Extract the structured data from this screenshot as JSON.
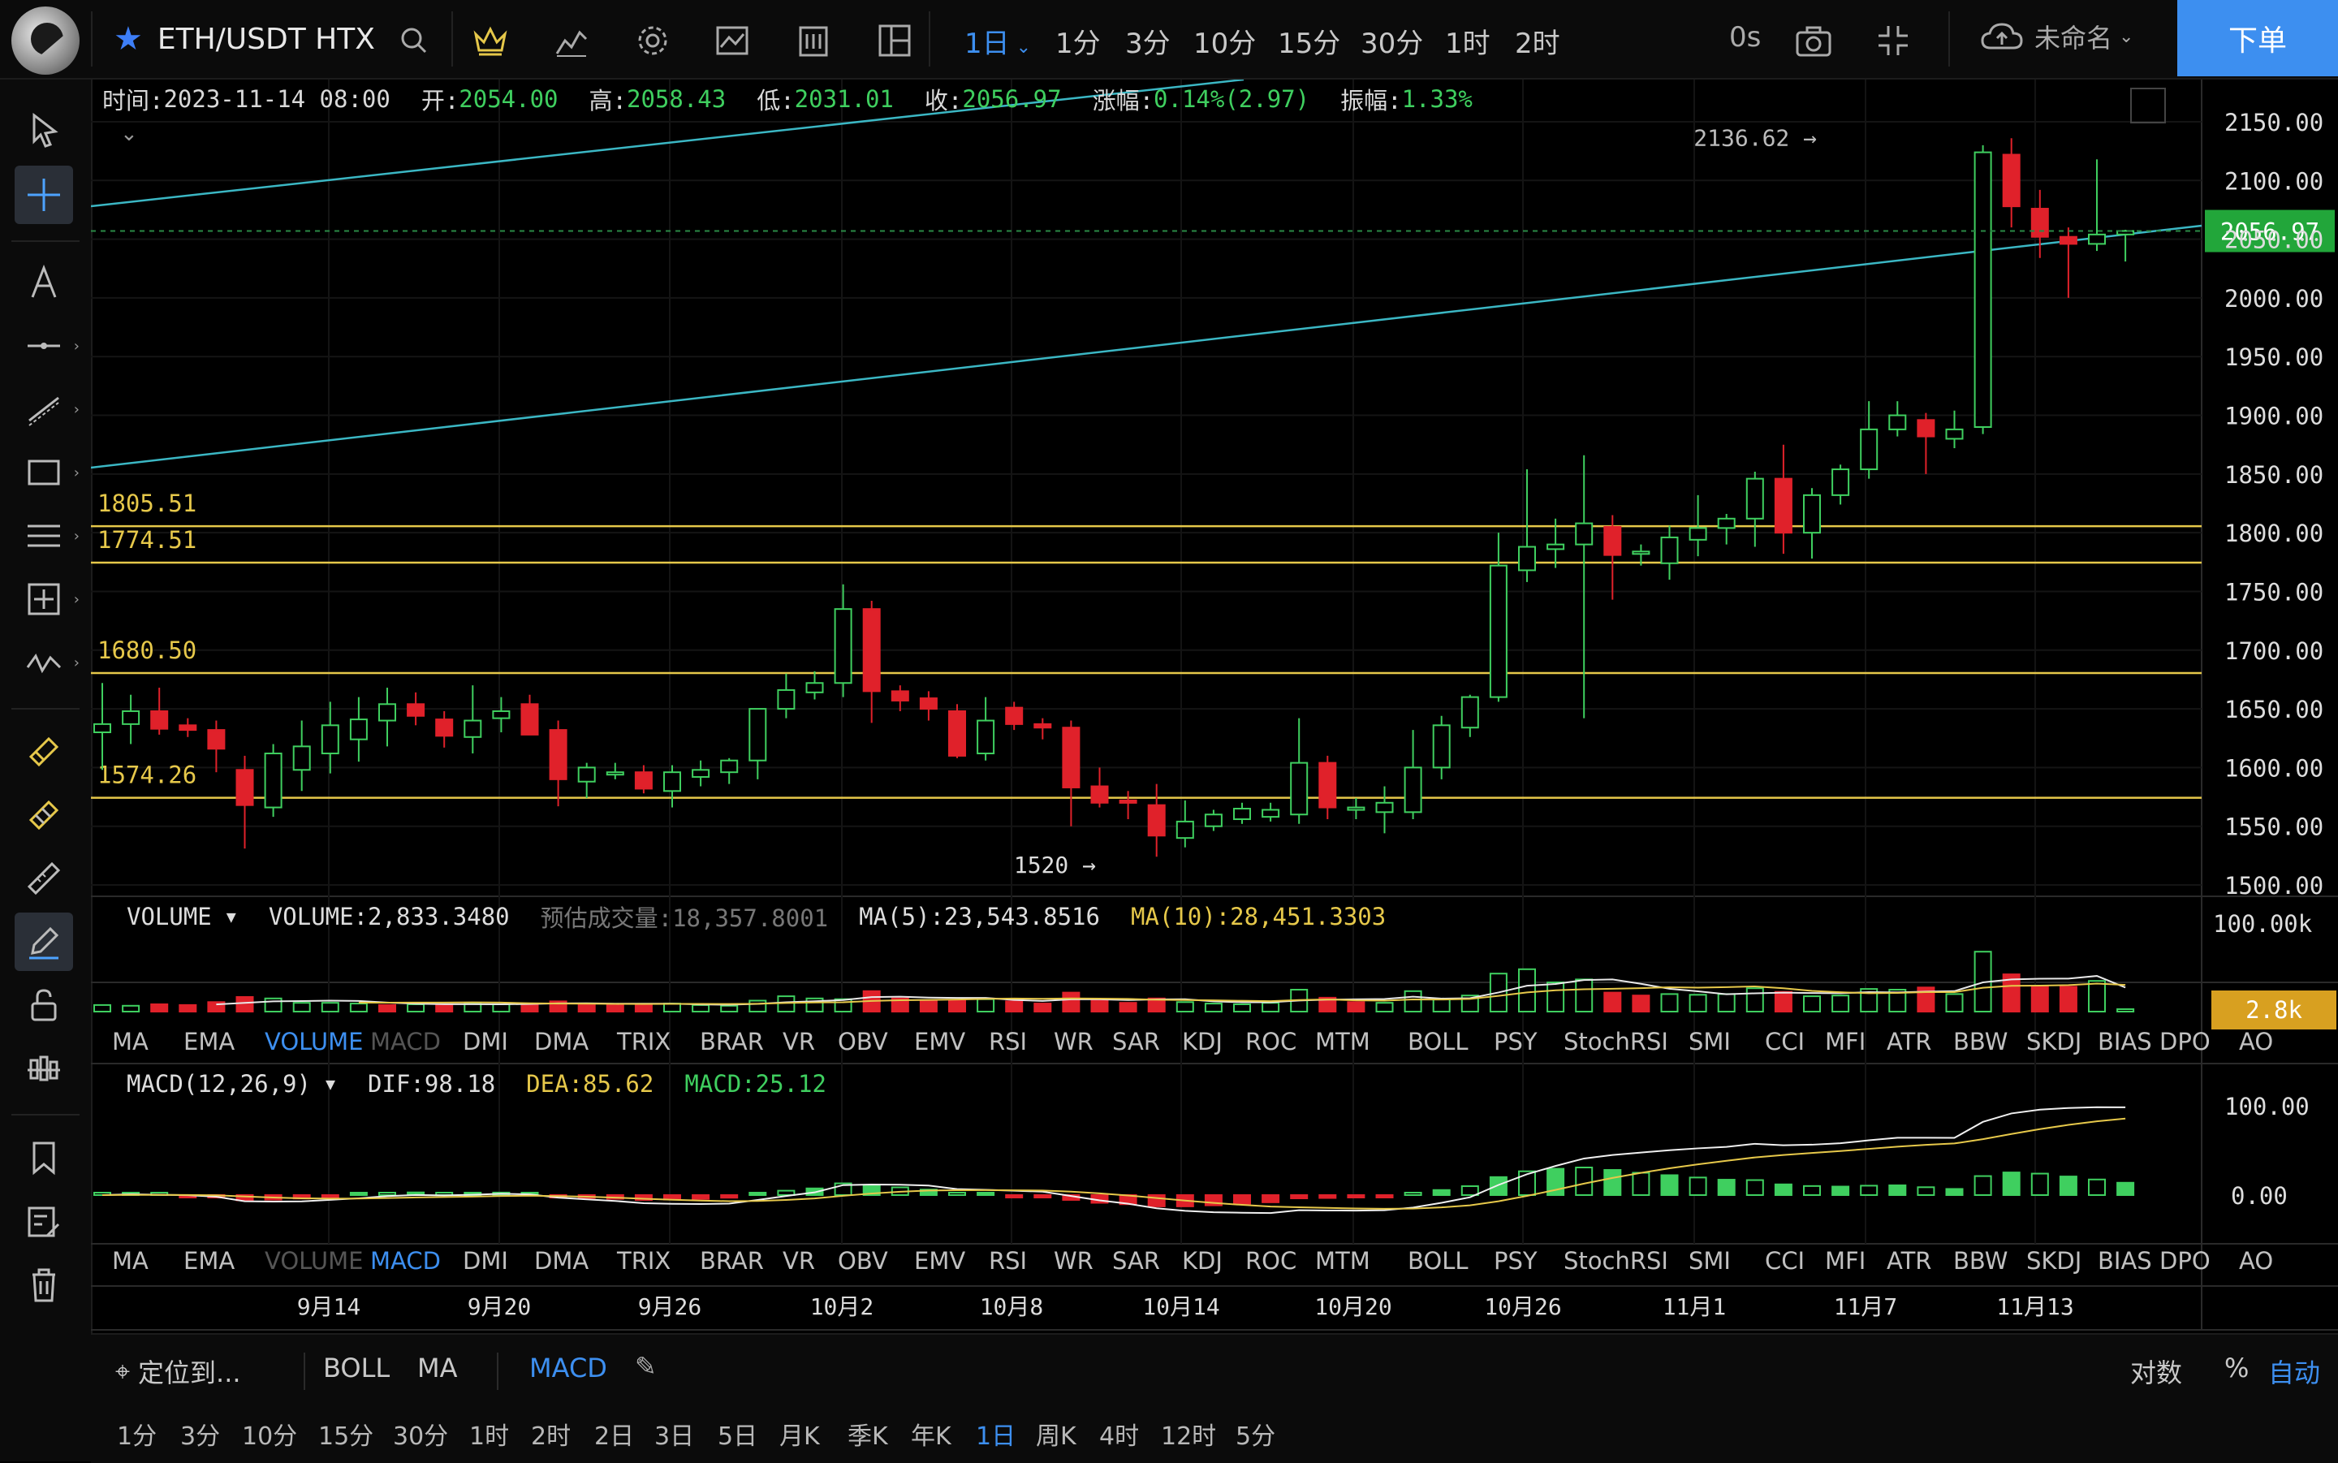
{
  "header": {
    "symbol": "ETH/USDT HTX",
    "timeframe_selected": "1日",
    "timeframes": [
      "1分",
      "3分",
      "10分",
      "15分",
      "30分",
      "1时",
      "2时"
    ],
    "countdown": "0s",
    "account_name": "未命名",
    "order_button": "下单"
  },
  "ohlc_bar": {
    "time_label": "时间:",
    "time_value": "2023-11-14 08:00",
    "open_label": "开:",
    "open": "2054.00",
    "high_label": "高:",
    "high": "2058.43",
    "low_label": "低:",
    "low": "2031.01",
    "close_label": "收:",
    "close": "2056.97",
    "change_label": "涨幅:",
    "change": "0.14%(2.97)",
    "amplitude_label": "振幅:",
    "amplitude": "1.33%"
  },
  "price_axis": {
    "ticks": [
      "2150.00",
      "2100.00",
      "2050.00",
      "2000.00",
      "1950.00",
      "1900.00",
      "1850.00",
      "1800.00",
      "1750.00",
      "1700.00",
      "1650.00",
      "1600.00",
      "1550.00",
      "1500.00"
    ],
    "current_price": "2056.97"
  },
  "horizontal_levels": [
    "1805.51",
    "1774.51",
    "1680.50",
    "1574.26"
  ],
  "annotations": {
    "high_marker": "2136.62",
    "low_marker": "1520"
  },
  "volume_panel": {
    "name": "VOLUME",
    "volume_text": "VOLUME:2,833.3480",
    "estimate_text": "预估成交量:18,357.8001",
    "ma5_text": "MA(5):23,543.8516",
    "ma10_text": "MA(10):28,451.3303",
    "axis_top": "100.00k",
    "current_badge": "2.8k"
  },
  "macd_panel": {
    "name": "MACD(12,26,9)",
    "dif_text": "DIF:98.18",
    "dea_text": "DEA:85.62",
    "macd_text": "MACD:25.12",
    "axis_ticks": [
      "100.00",
      "0.00"
    ]
  },
  "indicator_tabs": [
    "MA",
    "EMA",
    "VOLUME",
    "MACD",
    "DMI",
    "DMA",
    "TRIX",
    "BRAR",
    "VR",
    "OBV",
    "EMV",
    "RSI",
    "WR",
    "SAR",
    "KDJ",
    "ROC",
    "MTM",
    "BOLL",
    "PSY",
    "StochRSI",
    "SMI",
    "CCI",
    "MFI",
    "ATR",
    "BBW",
    "SKDJ",
    "BIAS",
    "DPO",
    "AO"
  ],
  "date_axis": [
    "9月14",
    "9月20",
    "9月26",
    "10月2",
    "10月8",
    "10月14",
    "10月20",
    "10月26",
    "11月1",
    "11月7",
    "11月13"
  ],
  "bottom": {
    "locate": "定位到...",
    "overlays": [
      "BOLL",
      "MA"
    ],
    "sub_indicator": "MACD",
    "scale_log": "对数",
    "scale_pct": "%",
    "scale_auto": "自动",
    "periods": [
      "1分",
      "3分",
      "10分",
      "15分",
      "30分",
      "1时",
      "2时",
      "2日",
      "3日",
      "5日",
      "月K",
      "季K",
      "年K",
      "1日",
      "周K",
      "4时",
      "12时",
      "5分"
    ],
    "period_selected": "1日"
  },
  "colors": {
    "up": "#3fcf5f",
    "down": "#e0212a",
    "accent": "#3d8ff0",
    "level": "#e6c84a",
    "trend": "#3bb7c4",
    "badge_price": "#22a63a",
    "badge_vol": "#d8a020"
  },
  "chart_data": {
    "type": "candlestick",
    "price_range": [
      1485,
      2170
    ],
    "candles": [
      [
        1630,
        1672,
        1598,
        1637
      ],
      [
        1637,
        1662,
        1620,
        1648
      ],
      [
        1648,
        1668,
        1628,
        1633
      ],
      [
        1636,
        1642,
        1626,
        1632
      ],
      [
        1632,
        1640,
        1596,
        1616
      ],
      [
        1598,
        1610,
        1531,
        1568
      ],
      [
        1566,
        1620,
        1558,
        1612
      ],
      [
        1598,
        1640,
        1580,
        1618
      ],
      [
        1612,
        1656,
        1595,
        1636
      ],
      [
        1624,
        1660,
        1605,
        1641
      ],
      [
        1640,
        1668,
        1618,
        1654
      ],
      [
        1654,
        1664,
        1636,
        1644
      ],
      [
        1641,
        1648,
        1617,
        1627
      ],
      [
        1626,
        1670,
        1612,
        1640
      ],
      [
        1642,
        1660,
        1630,
        1648
      ],
      [
        1654,
        1662,
        1628,
        1628
      ],
      [
        1632,
        1640,
        1567,
        1590
      ],
      [
        1588,
        1604,
        1574,
        1600
      ],
      [
        1596,
        1604,
        1590,
        1596
      ],
      [
        1596,
        1602,
        1578,
        1582
      ],
      [
        1580,
        1602,
        1566,
        1596
      ],
      [
        1592,
        1606,
        1584,
        1598
      ],
      [
        1596,
        1608,
        1586,
        1606
      ],
      [
        1606,
        1650,
        1590,
        1650
      ],
      [
        1650,
        1680,
        1642,
        1666
      ],
      [
        1664,
        1682,
        1658,
        1672
      ],
      [
        1672,
        1756,
        1660,
        1735
      ],
      [
        1735,
        1742,
        1638,
        1665
      ],
      [
        1665,
        1670,
        1648,
        1657
      ],
      [
        1659,
        1665,
        1640,
        1650
      ],
      [
        1648,
        1654,
        1608,
        1610
      ],
      [
        1612,
        1660,
        1606,
        1640
      ],
      [
        1651,
        1656,
        1632,
        1637
      ],
      [
        1637,
        1642,
        1624,
        1634
      ],
      [
        1634,
        1640,
        1550,
        1583
      ],
      [
        1584,
        1600,
        1566,
        1570
      ],
      [
        1572,
        1580,
        1556,
        1570
      ],
      [
        1568,
        1586,
        1524,
        1542
      ],
      [
        1540,
        1572,
        1532,
        1554
      ],
      [
        1550,
        1564,
        1546,
        1560
      ],
      [
        1556,
        1570,
        1552,
        1565
      ],
      [
        1558,
        1570,
        1554,
        1564
      ],
      [
        1560,
        1642,
        1552,
        1604
      ],
      [
        1604,
        1610,
        1556,
        1566
      ],
      [
        1564,
        1574,
        1556,
        1566
      ],
      [
        1562,
        1584,
        1544,
        1570
      ],
      [
        1562,
        1632,
        1556,
        1600
      ],
      [
        1600,
        1644,
        1590,
        1636
      ],
      [
        1634,
        1662,
        1626,
        1660
      ],
      [
        1660,
        1800,
        1656,
        1772
      ],
      [
        1768,
        1854,
        1758,
        1788
      ],
      [
        1786,
        1812,
        1770,
        1790
      ],
      [
        1790,
        1866,
        1642,
        1808
      ],
      [
        1805,
        1815,
        1743,
        1781
      ],
      [
        1782,
        1790,
        1772,
        1784
      ],
      [
        1774,
        1806,
        1760,
        1796
      ],
      [
        1794,
        1832,
        1780,
        1804
      ],
      [
        1804,
        1816,
        1790,
        1812
      ],
      [
        1812,
        1852,
        1788,
        1846
      ],
      [
        1846,
        1875,
        1782,
        1800
      ],
      [
        1800,
        1838,
        1778,
        1832
      ],
      [
        1832,
        1858,
        1824,
        1854
      ],
      [
        1854,
        1912,
        1846,
        1888
      ],
      [
        1888,
        1912,
        1882,
        1900
      ],
      [
        1896,
        1902,
        1850,
        1882
      ],
      [
        1880,
        1904,
        1872,
        1888
      ],
      [
        1890,
        2130,
        1884,
        2124
      ],
      [
        2122,
        2136,
        2060,
        2078
      ],
      [
        2076,
        2092,
        2034,
        2052
      ],
      [
        2052,
        2060,
        2000,
        2046
      ],
      [
        2046,
        2118,
        2040,
        2054
      ],
      [
        2054,
        2058,
        2031,
        2057
      ]
    ],
    "volume": [
      [
        9,
        1
      ],
      [
        8,
        1
      ],
      [
        10,
        0
      ],
      [
        9,
        0
      ],
      [
        13,
        0
      ],
      [
        20,
        0
      ],
      [
        18,
        1
      ],
      [
        12,
        1
      ],
      [
        12,
        1
      ],
      [
        11,
        1
      ],
      [
        9,
        0
      ],
      [
        10,
        1
      ],
      [
        9,
        0
      ],
      [
        12,
        1
      ],
      [
        10,
        1
      ],
      [
        11,
        0
      ],
      [
        14,
        0
      ],
      [
        10,
        0
      ],
      [
        9,
        0
      ],
      [
        10,
        0
      ],
      [
        11,
        1
      ],
      [
        9,
        1
      ],
      [
        8,
        1
      ],
      [
        15,
        1
      ],
      [
        21,
        1
      ],
      [
        18,
        1
      ],
      [
        17,
        1
      ],
      [
        28,
        0
      ],
      [
        18,
        0
      ],
      [
        15,
        0
      ],
      [
        16,
        0
      ],
      [
        17,
        1
      ],
      [
        14,
        0
      ],
      [
        11,
        0
      ],
      [
        26,
        0
      ],
      [
        16,
        0
      ],
      [
        12,
        0
      ],
      [
        18,
        0
      ],
      [
        13,
        1
      ],
      [
        11,
        1
      ],
      [
        10,
        1
      ],
      [
        12,
        1
      ],
      [
        30,
        1
      ],
      [
        19,
        0
      ],
      [
        13,
        0
      ],
      [
        12,
        1
      ],
      [
        28,
        1
      ],
      [
        17,
        1
      ],
      [
        22,
        1
      ],
      [
        52,
        1
      ],
      [
        58,
        1
      ],
      [
        40,
        1
      ],
      [
        44,
        1
      ],
      [
        26,
        0
      ],
      [
        22,
        0
      ],
      [
        24,
        1
      ],
      [
        23,
        1
      ],
      [
        24,
        1
      ],
      [
        32,
        1
      ],
      [
        27,
        0
      ],
      [
        21,
        1
      ],
      [
        22,
        1
      ],
      [
        31,
        1
      ],
      [
        30,
        1
      ],
      [
        33,
        0
      ],
      [
        24,
        1
      ],
      [
        82,
        1
      ],
      [
        51,
        0
      ],
      [
        35,
        0
      ],
      [
        34,
        0
      ],
      [
        42,
        1
      ],
      [
        3,
        1
      ]
    ]
  }
}
